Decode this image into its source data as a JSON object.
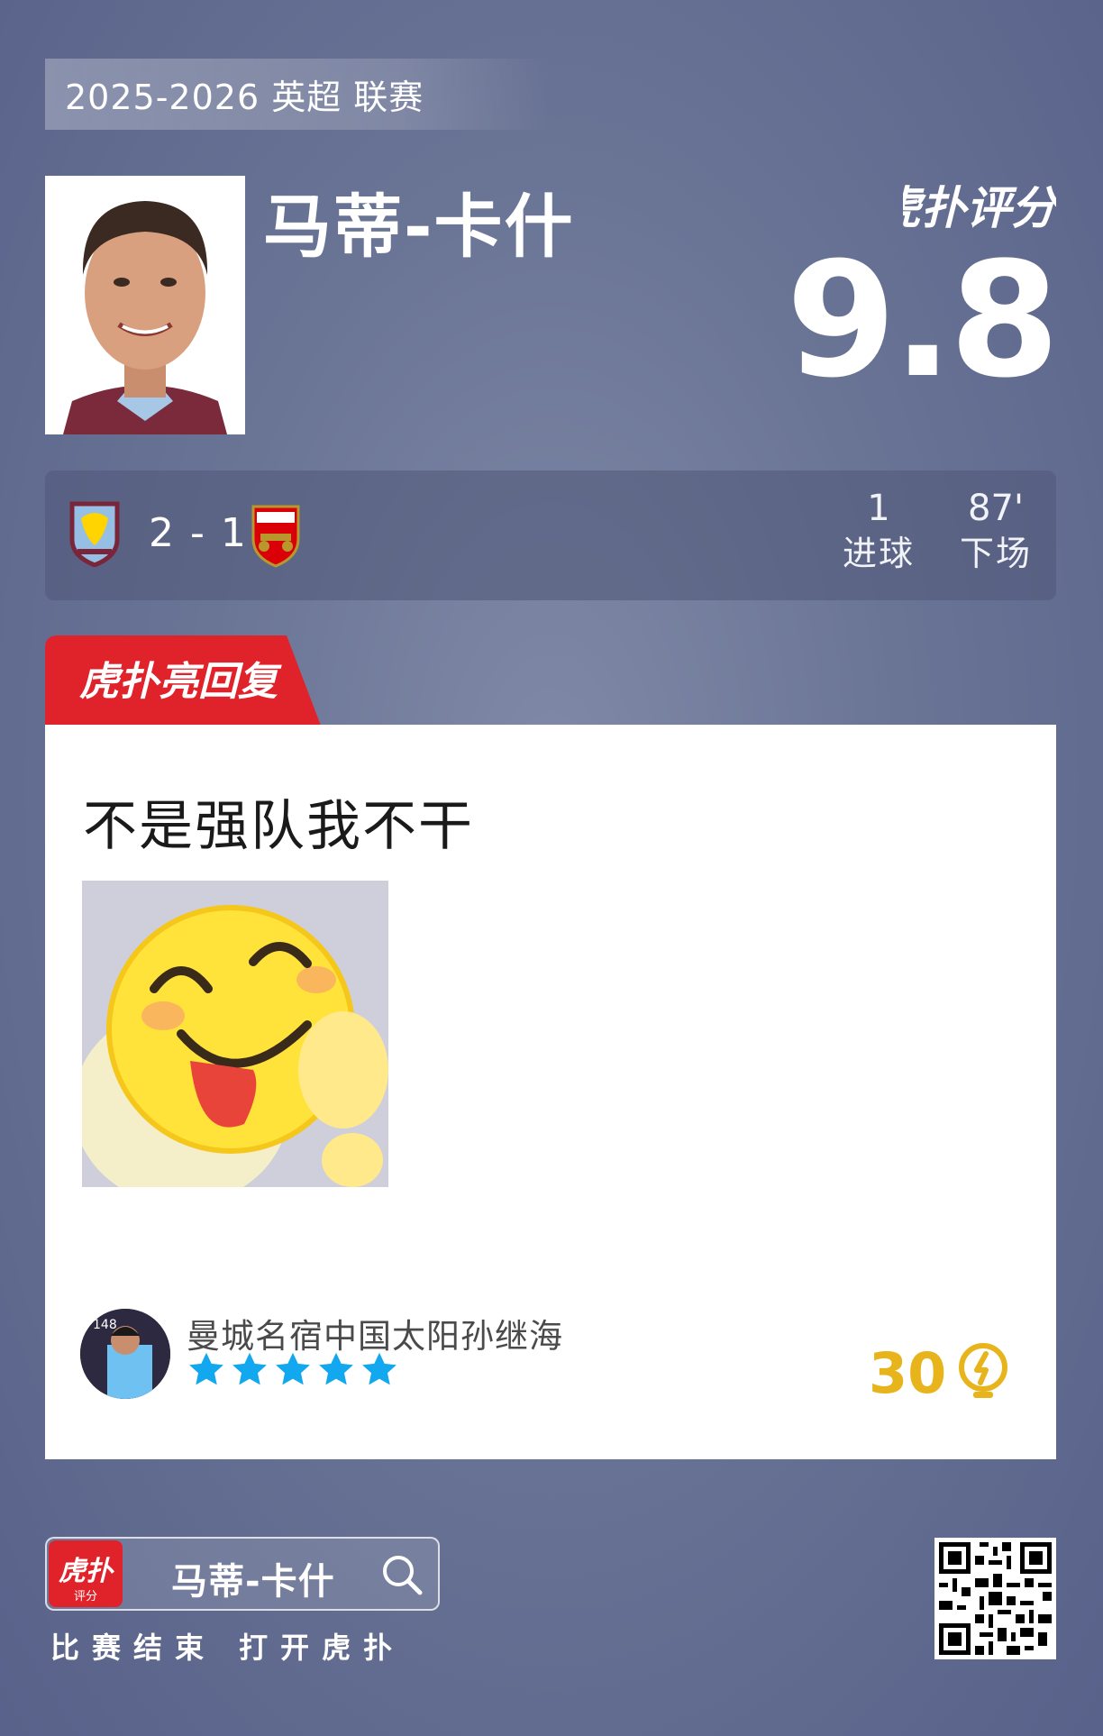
{
  "season": "2025-2026 英超 联赛",
  "player": {
    "name": "马蒂-卡什"
  },
  "rating": {
    "brand": "虎扑评分",
    "value": "9.8"
  },
  "match": {
    "score": "2 - 1",
    "home_team": "Aston Villa",
    "away_team": "Arsenal",
    "stats": [
      {
        "value": "1",
        "label": "进球"
      },
      {
        "value": "87'",
        "label": "下场"
      }
    ]
  },
  "highlight": {
    "tab_label": "虎扑亮回复",
    "comment": "不是强队我不干",
    "user": {
      "name": "曼城名宿中国太阳孙继海",
      "stars": 5,
      "jersey": "148"
    },
    "likes": "30"
  },
  "footer": {
    "app_badge": "虎扑",
    "app_badge_sub": "评分",
    "search_text": "马蒂-卡什",
    "caption": "比赛结束 打开虎扑"
  },
  "colors": {
    "accent_red": "#e0232b",
    "like_yellow": "#e8b41c",
    "star_blue": "#12a8f0"
  }
}
